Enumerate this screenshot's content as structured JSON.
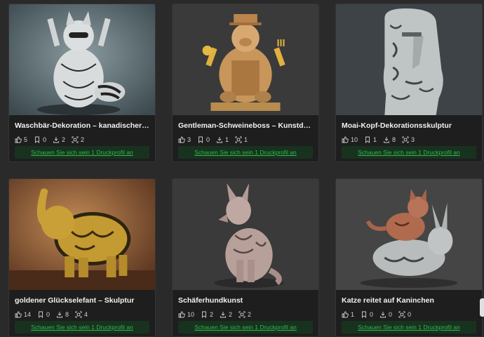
{
  "cards": [
    {
      "title": "Waschbär-Dekoration – kanadischer Fr…",
      "likes": "5",
      "collections": "0",
      "downloads": "2",
      "prints": "2",
      "button": "Schauen Sie sich sein 1 Druckprofil an"
    },
    {
      "title": "Gentleman-Schweineboss – Kunstdeko…",
      "likes": "3",
      "collections": "0",
      "downloads": "1",
      "prints": "1",
      "button": "Schauen Sie sich sein 1 Druckprofil an"
    },
    {
      "title": "Moai-Kopf-Dekorationsskulptur",
      "likes": "10",
      "collections": "1",
      "downloads": "8",
      "prints": "3",
      "button": "Schauen Sie sich sein 1 Druckprofil an"
    },
    {
      "title": "goldener Glückselefant – Skulptur",
      "likes": "14",
      "collections": "0",
      "downloads": "8",
      "prints": "4",
      "button": "Schauen Sie sich sein 1 Druckprofil an"
    },
    {
      "title": "Schäferhundkunst",
      "likes": "10",
      "collections": "2",
      "downloads": "2",
      "prints": "2",
      "button": "Schauen Sie sich sein 1 Druckprofil an"
    },
    {
      "title": "Katze reitet auf Kaninchen",
      "likes": "1",
      "collections": "0",
      "downloads": "0",
      "prints": "0",
      "button": "Schauen Sie sich sein 1 Druckprofil an"
    }
  ],
  "icons": {
    "likes": "thumbs-up-icon",
    "collections": "bookmark-icon",
    "downloads": "download-icon",
    "prints": "print-icon"
  },
  "colors": {
    "background": "#2a2a2a",
    "card": "#1e1e1e",
    "button_bg": "#18321f",
    "button_text": "#2fb84a"
  }
}
